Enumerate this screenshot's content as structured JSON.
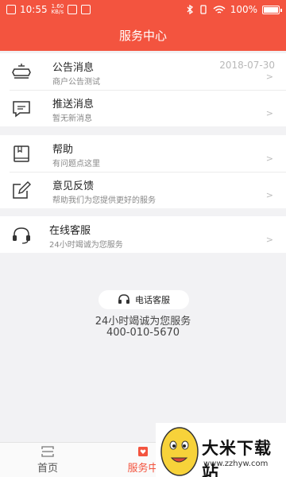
{
  "status_bar": {
    "time": "10:55",
    "speed_top": "1.60",
    "speed_bottom": "KB/s",
    "battery": "100%"
  },
  "header": {
    "title": "服务中心"
  },
  "messages": [
    {
      "title": "公告消息",
      "subtitle": "商户公告测试",
      "date": "2018-07-30",
      "icon": "megaphone-icon"
    },
    {
      "title": "推送消息",
      "subtitle": "暂无新消息",
      "icon": "chat-bubble-icon"
    }
  ],
  "help_items": [
    {
      "title": "帮助",
      "subtitle": "有问题点这里",
      "icon": "book-icon"
    },
    {
      "title": "意见反馈",
      "subtitle": "帮助我们为您提供更好的服务",
      "icon": "edit-icon"
    }
  ],
  "online_service": {
    "title": "在线客服",
    "subtitle": "24小时竭诚为您服务",
    "icon": "headset-icon"
  },
  "arrow": ">",
  "phone_service": {
    "button_label": "电话客服",
    "tagline": "24小时竭诚为您服务",
    "number": "400-010-5670"
  },
  "tabs": [
    {
      "label": "首页",
      "active": false
    },
    {
      "label": "服务中",
      "active": true
    }
  ],
  "watermark": {
    "name": "大米下载站",
    "url": "www.zzhyw.com"
  },
  "colors": {
    "accent": "#f3543f",
    "background": "#f2f2f4"
  }
}
